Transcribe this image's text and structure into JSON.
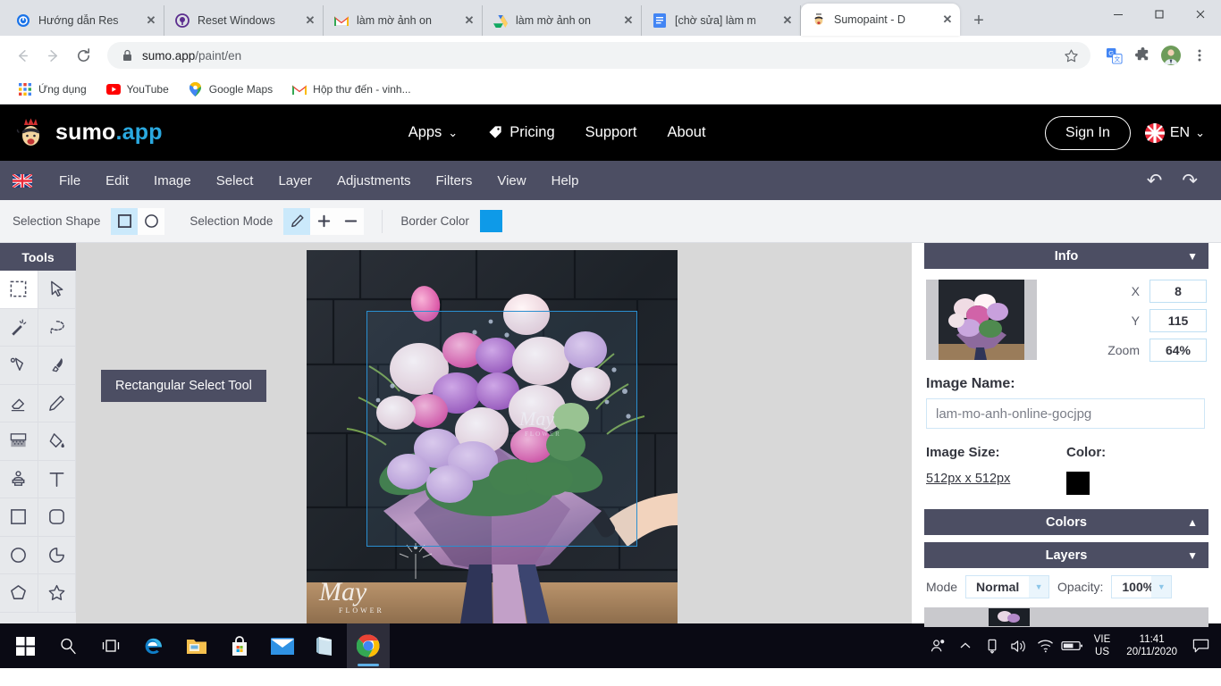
{
  "browser": {
    "tabs": [
      {
        "title": "Hướng dẫn Res",
        "favicon": "shield-blue-icon",
        "active": false
      },
      {
        "title": "Reset Windows",
        "favicon": "circle-purple-icon",
        "active": false
      },
      {
        "title": "làm mờ ảnh on",
        "favicon": "gmail-icon",
        "active": false
      },
      {
        "title": "làm mờ ảnh on",
        "favicon": "google-drive-icon",
        "active": false
      },
      {
        "title": "[chờ sửa] làm m",
        "favicon": "google-docs-icon",
        "active": false
      },
      {
        "title": "Sumopaint - D",
        "favicon": "sumo-icon",
        "active": true
      }
    ],
    "new_tab_label": "+",
    "close_label": "✕",
    "window_controls": {
      "minimize": "—",
      "maximize": "❐",
      "close": "✕"
    },
    "nav": {
      "back": "←",
      "forward": "→",
      "reload": "⟳"
    },
    "url_host": "sumo.app",
    "url_path": "/paint/en",
    "lock_icon": "lock-icon",
    "toolbar_icons": [
      "star-icon",
      "translate-icon",
      "extensions-icon",
      "avatar-icon",
      "kebab-menu-icon"
    ],
    "bookmarks": [
      {
        "label": "Ứng dụng",
        "icon": "apps-grid-icon"
      },
      {
        "label": "YouTube",
        "icon": "youtube-icon"
      },
      {
        "label": "Google Maps",
        "icon": "maps-pin-icon"
      },
      {
        "label": "Hộp thư đến - vinh...",
        "icon": "gmail-icon"
      }
    ]
  },
  "sumo_header": {
    "brand_main": "sumo",
    "brand_accent": ".app",
    "nav": [
      {
        "label": "Apps",
        "caret": "⌄",
        "icon": null
      },
      {
        "label": "Pricing",
        "caret": null,
        "icon": "tag-icon"
      },
      {
        "label": "Support",
        "caret": null,
        "icon": null
      },
      {
        "label": "About",
        "caret": null,
        "icon": null
      }
    ],
    "sign_in": "Sign In",
    "language": "EN",
    "language_caret": "⌄",
    "flag": "uk-flag-icon"
  },
  "menubar": {
    "flag": "uk-flag-icon",
    "items": [
      "File",
      "Edit",
      "Image",
      "Select",
      "Layer",
      "Adjustments",
      "Filters",
      "View",
      "Help"
    ],
    "undo": "↶",
    "redo": "↷"
  },
  "optionbar": {
    "selection_shape_label": "Selection Shape",
    "shapes": [
      {
        "name": "rectangle-shape",
        "active": true
      },
      {
        "name": "ellipse-shape",
        "active": false
      }
    ],
    "selection_mode_label": "Selection Mode",
    "modes": [
      {
        "name": "new-selection",
        "glyph": "pencil",
        "active": true
      },
      {
        "name": "add-selection",
        "glyph": "+",
        "active": false
      },
      {
        "name": "subtract-selection",
        "glyph": "−",
        "active": false
      }
    ],
    "border_color_label": "Border Color",
    "border_color": "#0e9ae8"
  },
  "tools": {
    "title": "Tools",
    "items": [
      {
        "name": "rectangular-select-tool",
        "active": true
      },
      {
        "name": "move-tool",
        "active": false
      },
      {
        "name": "magic-wand-tool",
        "active": false
      },
      {
        "name": "lasso-tool",
        "active": false
      },
      {
        "name": "pen-tool",
        "active": false
      },
      {
        "name": "brush-tool",
        "active": false
      },
      {
        "name": "eraser-tool",
        "active": false
      },
      {
        "name": "pencil-tool",
        "active": false
      },
      {
        "name": "gradient-tool",
        "active": false
      },
      {
        "name": "paint-bucket-tool",
        "active": false
      },
      {
        "name": "stamp-tool",
        "active": false
      },
      {
        "name": "text-tool",
        "active": false
      },
      {
        "name": "rectangle-shape-tool",
        "active": false
      },
      {
        "name": "rounded-rect-tool",
        "active": false
      },
      {
        "name": "ellipse-shape-tool",
        "active": false
      },
      {
        "name": "pie-shape-tool",
        "active": false
      },
      {
        "name": "polygon-tool",
        "active": false
      },
      {
        "name": "star-tool",
        "active": false
      }
    ],
    "tooltip": "Rectangular Select Tool"
  },
  "info_panel": {
    "title": "Info",
    "caret": "▼",
    "x_label": "X",
    "x_value": "8",
    "y_label": "Y",
    "y_value": "115",
    "zoom_label": "Zoom",
    "zoom_value": "64%",
    "image_name_label": "Image Name:",
    "image_name_value": "lam-mo-anh-online-gocjpg",
    "image_size_label": "Image Size:",
    "image_size_value": "512px x 512px",
    "color_label": "Color:",
    "color_value": "#000000"
  },
  "colors_panel": {
    "title": "Colors",
    "caret": "▲"
  },
  "layers_panel": {
    "title": "Layers",
    "caret": "▼",
    "mode_label": "Mode",
    "mode_value": "Normal",
    "opacity_label": "Opacity:",
    "opacity_value": "100%",
    "dropdown_caret": "▼"
  },
  "taskbar": {
    "items": [
      {
        "name": "start-button",
        "icon": "windows-logo-icon"
      },
      {
        "name": "search-button",
        "icon": "search-icon"
      },
      {
        "name": "task-view-button",
        "icon": "task-view-icon"
      },
      {
        "name": "edge-button",
        "icon": "edge-icon"
      },
      {
        "name": "file-explorer-button",
        "icon": "folder-icon"
      },
      {
        "name": "microsoft-store-button",
        "icon": "store-icon"
      },
      {
        "name": "mail-button",
        "icon": "mail-icon"
      },
      {
        "name": "notepad-button",
        "icon": "notepad-icon"
      },
      {
        "name": "chrome-button",
        "icon": "chrome-icon"
      }
    ],
    "tray": [
      "people-icon",
      "chevron-up-icon",
      "usb-icon",
      "volume-icon",
      "wifi-icon",
      "battery-icon"
    ],
    "lang_line1": "VIE",
    "lang_line2": "US",
    "time": "11:41",
    "date": "20/11/2020",
    "notification_icon": "notification-icon"
  }
}
